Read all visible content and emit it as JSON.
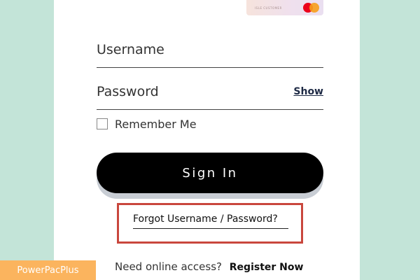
{
  "card_preview": {
    "text": "ISLE CUSTOMER",
    "logo": "mastercard-logo"
  },
  "form": {
    "username_label": "Username",
    "password_label": "Password",
    "show_label": "Show",
    "remember_label": "Remember Me",
    "remember_checked": false,
    "signin_label": "Sign In",
    "forgot_label": "Forgot Username / Password?"
  },
  "footer": {
    "access_prompt": "Need online access?",
    "register_label": "Register Now"
  },
  "watermark": {
    "text": "PowerPacPlus"
  },
  "colors": {
    "background": "#c3e4d8",
    "button": "#000000",
    "highlight_box": "#c9473d",
    "watermark": "#fbb45e"
  }
}
